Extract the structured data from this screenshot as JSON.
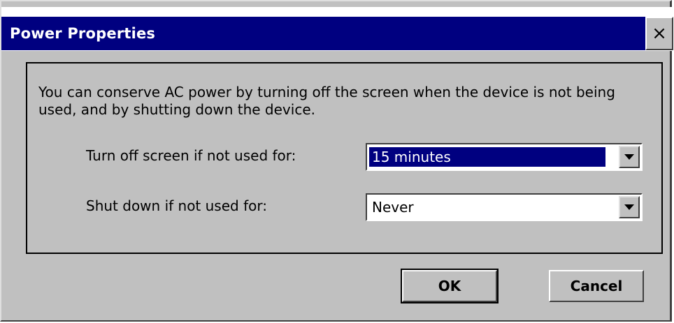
{
  "window": {
    "title": "Power Properties",
    "close_glyph": "×"
  },
  "group": {
    "description": "You can conserve AC power by turning off the screen when the device is not being used, and by shutting down the device."
  },
  "screen_off": {
    "label": "Turn off screen if not used for:",
    "value": "15 minutes"
  },
  "shutdown": {
    "label": "Shut down if not used for:",
    "value": "Never"
  },
  "buttons": {
    "ok": "OK",
    "cancel": "Cancel"
  },
  "colors": {
    "title_bar": "#000080",
    "face": "#c0c0c0",
    "selection": "#000080"
  }
}
